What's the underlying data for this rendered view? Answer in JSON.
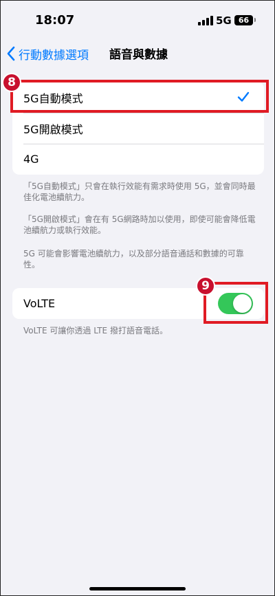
{
  "status_bar": {
    "time": "18:07",
    "network": "5G",
    "battery": "66"
  },
  "nav": {
    "back_label": "行動數據選項",
    "title": "語音與數據"
  },
  "modes": {
    "items": [
      {
        "label": "5G自動模式",
        "selected": true
      },
      {
        "label": "5G開啟模式",
        "selected": false
      },
      {
        "label": "4G",
        "selected": false
      }
    ]
  },
  "notes": {
    "auto": "「5G自動模式」只會在執行效能有需求時使用 5G，並會同時最佳化電池續航力。",
    "on": "「5G開啟模式」會在有 5G網路時加以使用，即使可能會降低電池續航力或執行效能。",
    "battery": "5G 可能會影響電池續航力，以及部分語音通話和數據的可靠性。"
  },
  "volte": {
    "label": "VoLTE",
    "enabled": true,
    "note": "VoLTE 可讓你透過 LTE 撥打語音電話。"
  },
  "annotations": {
    "badge_8": "8",
    "badge_9": "9"
  },
  "colors": {
    "accent": "#007aff",
    "toggle_on": "#34c759",
    "highlight": "#e01b24",
    "background": "#f2f2f7"
  }
}
